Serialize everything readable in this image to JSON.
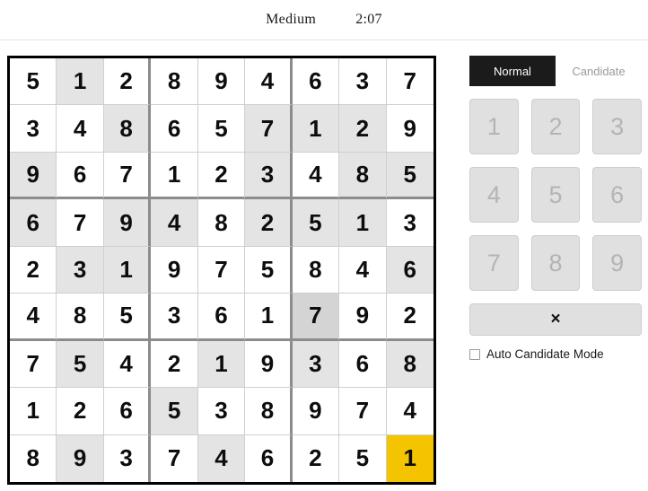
{
  "header": {
    "difficulty": "Medium",
    "timer": "2:07"
  },
  "board": {
    "rows": [
      [
        {
          "value": "5",
          "state": "normal"
        },
        {
          "value": "1",
          "state": "peer"
        },
        {
          "value": "2",
          "state": "normal"
        },
        {
          "value": "8",
          "state": "normal"
        },
        {
          "value": "9",
          "state": "normal"
        },
        {
          "value": "4",
          "state": "normal"
        },
        {
          "value": "6",
          "state": "normal"
        },
        {
          "value": "3",
          "state": "normal"
        },
        {
          "value": "7",
          "state": "normal"
        }
      ],
      [
        {
          "value": "3",
          "state": "normal"
        },
        {
          "value": "4",
          "state": "normal"
        },
        {
          "value": "8",
          "state": "peer"
        },
        {
          "value": "6",
          "state": "normal"
        },
        {
          "value": "5",
          "state": "normal"
        },
        {
          "value": "7",
          "state": "peer"
        },
        {
          "value": "1",
          "state": "peer"
        },
        {
          "value": "2",
          "state": "peer"
        },
        {
          "value": "9",
          "state": "normal"
        }
      ],
      [
        {
          "value": "9",
          "state": "peer"
        },
        {
          "value": "6",
          "state": "normal"
        },
        {
          "value": "7",
          "state": "normal"
        },
        {
          "value": "1",
          "state": "normal"
        },
        {
          "value": "2",
          "state": "normal"
        },
        {
          "value": "3",
          "state": "peer"
        },
        {
          "value": "4",
          "state": "normal"
        },
        {
          "value": "8",
          "state": "peer"
        },
        {
          "value": "5",
          "state": "peer"
        }
      ],
      [
        {
          "value": "6",
          "state": "peer"
        },
        {
          "value": "7",
          "state": "normal"
        },
        {
          "value": "9",
          "state": "peer"
        },
        {
          "value": "4",
          "state": "peer"
        },
        {
          "value": "8",
          "state": "normal"
        },
        {
          "value": "2",
          "state": "peer"
        },
        {
          "value": "5",
          "state": "peer"
        },
        {
          "value": "1",
          "state": "peer"
        },
        {
          "value": "3",
          "state": "normal"
        }
      ],
      [
        {
          "value": "2",
          "state": "normal"
        },
        {
          "value": "3",
          "state": "peer"
        },
        {
          "value": "1",
          "state": "peer"
        },
        {
          "value": "9",
          "state": "normal"
        },
        {
          "value": "7",
          "state": "normal"
        },
        {
          "value": "5",
          "state": "normal"
        },
        {
          "value": "8",
          "state": "normal"
        },
        {
          "value": "4",
          "state": "normal"
        },
        {
          "value": "6",
          "state": "peer"
        }
      ],
      [
        {
          "value": "4",
          "state": "normal"
        },
        {
          "value": "8",
          "state": "normal"
        },
        {
          "value": "5",
          "state": "normal"
        },
        {
          "value": "3",
          "state": "normal"
        },
        {
          "value": "6",
          "state": "normal"
        },
        {
          "value": "1",
          "state": "normal"
        },
        {
          "value": "7",
          "state": "peer2"
        },
        {
          "value": "9",
          "state": "normal"
        },
        {
          "value": "2",
          "state": "normal"
        }
      ],
      [
        {
          "value": "7",
          "state": "normal"
        },
        {
          "value": "5",
          "state": "peer"
        },
        {
          "value": "4",
          "state": "normal"
        },
        {
          "value": "2",
          "state": "normal"
        },
        {
          "value": "1",
          "state": "peer"
        },
        {
          "value": "9",
          "state": "normal"
        },
        {
          "value": "3",
          "state": "peer"
        },
        {
          "value": "6",
          "state": "normal"
        },
        {
          "value": "8",
          "state": "peer"
        }
      ],
      [
        {
          "value": "1",
          "state": "normal"
        },
        {
          "value": "2",
          "state": "normal"
        },
        {
          "value": "6",
          "state": "normal"
        },
        {
          "value": "5",
          "state": "peer"
        },
        {
          "value": "3",
          "state": "normal"
        },
        {
          "value": "8",
          "state": "normal"
        },
        {
          "value": "9",
          "state": "normal"
        },
        {
          "value": "7",
          "state": "normal"
        },
        {
          "value": "4",
          "state": "normal"
        }
      ],
      [
        {
          "value": "8",
          "state": "normal"
        },
        {
          "value": "9",
          "state": "peer"
        },
        {
          "value": "3",
          "state": "normal"
        },
        {
          "value": "7",
          "state": "normal"
        },
        {
          "value": "4",
          "state": "peer"
        },
        {
          "value": "6",
          "state": "normal"
        },
        {
          "value": "2",
          "state": "normal"
        },
        {
          "value": "5",
          "state": "normal"
        },
        {
          "value": "1",
          "state": "selected"
        }
      ]
    ]
  },
  "panel": {
    "tabs": [
      {
        "label": "Normal",
        "active": true
      },
      {
        "label": "Candidate",
        "active": false
      }
    ],
    "numbers": [
      "1",
      "2",
      "3",
      "4",
      "5",
      "6",
      "7",
      "8",
      "9"
    ],
    "erase_label": "×",
    "auto_candidate_label": "Auto Candidate Mode",
    "auto_candidate_checked": false
  },
  "colors": {
    "selected": "#f5c400",
    "peer": "#e4e4e4",
    "peer_strong": "#d4d4d4",
    "tab_active_bg": "#1b1b1b",
    "button_bg": "#e0e0e0"
  }
}
